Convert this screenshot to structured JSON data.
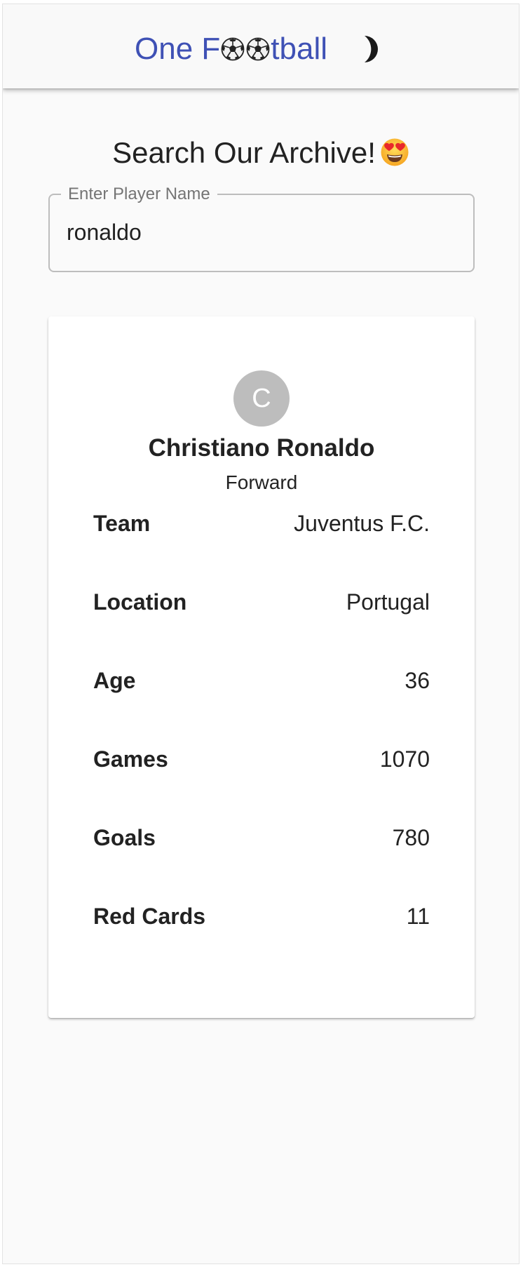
{
  "app_bar": {
    "title_start": "One F",
    "title_end": "tball",
    "title_icons": [
      "soccer-ball-icon",
      "soccer-ball-icon"
    ],
    "theme_toggle_icon": "moon-icon",
    "title_color": "#3f51b5"
  },
  "search": {
    "heading": "Search Our Archive!",
    "heading_icon": "heart-eyes-emoji-icon",
    "field_label": "Enter Player Name",
    "value": "ronaldo"
  },
  "player": {
    "avatar_initial": "C",
    "name": "Christiano Ronaldo",
    "position": "Forward",
    "stats": [
      {
        "label": "Team",
        "value": "Juventus F.C."
      },
      {
        "label": "Location",
        "value": "Portugal"
      },
      {
        "label": "Age",
        "value": "36"
      },
      {
        "label": "Games",
        "value": "1070"
      },
      {
        "label": "Goals",
        "value": "780"
      },
      {
        "label": "Red Cards",
        "value": "11"
      }
    ]
  }
}
